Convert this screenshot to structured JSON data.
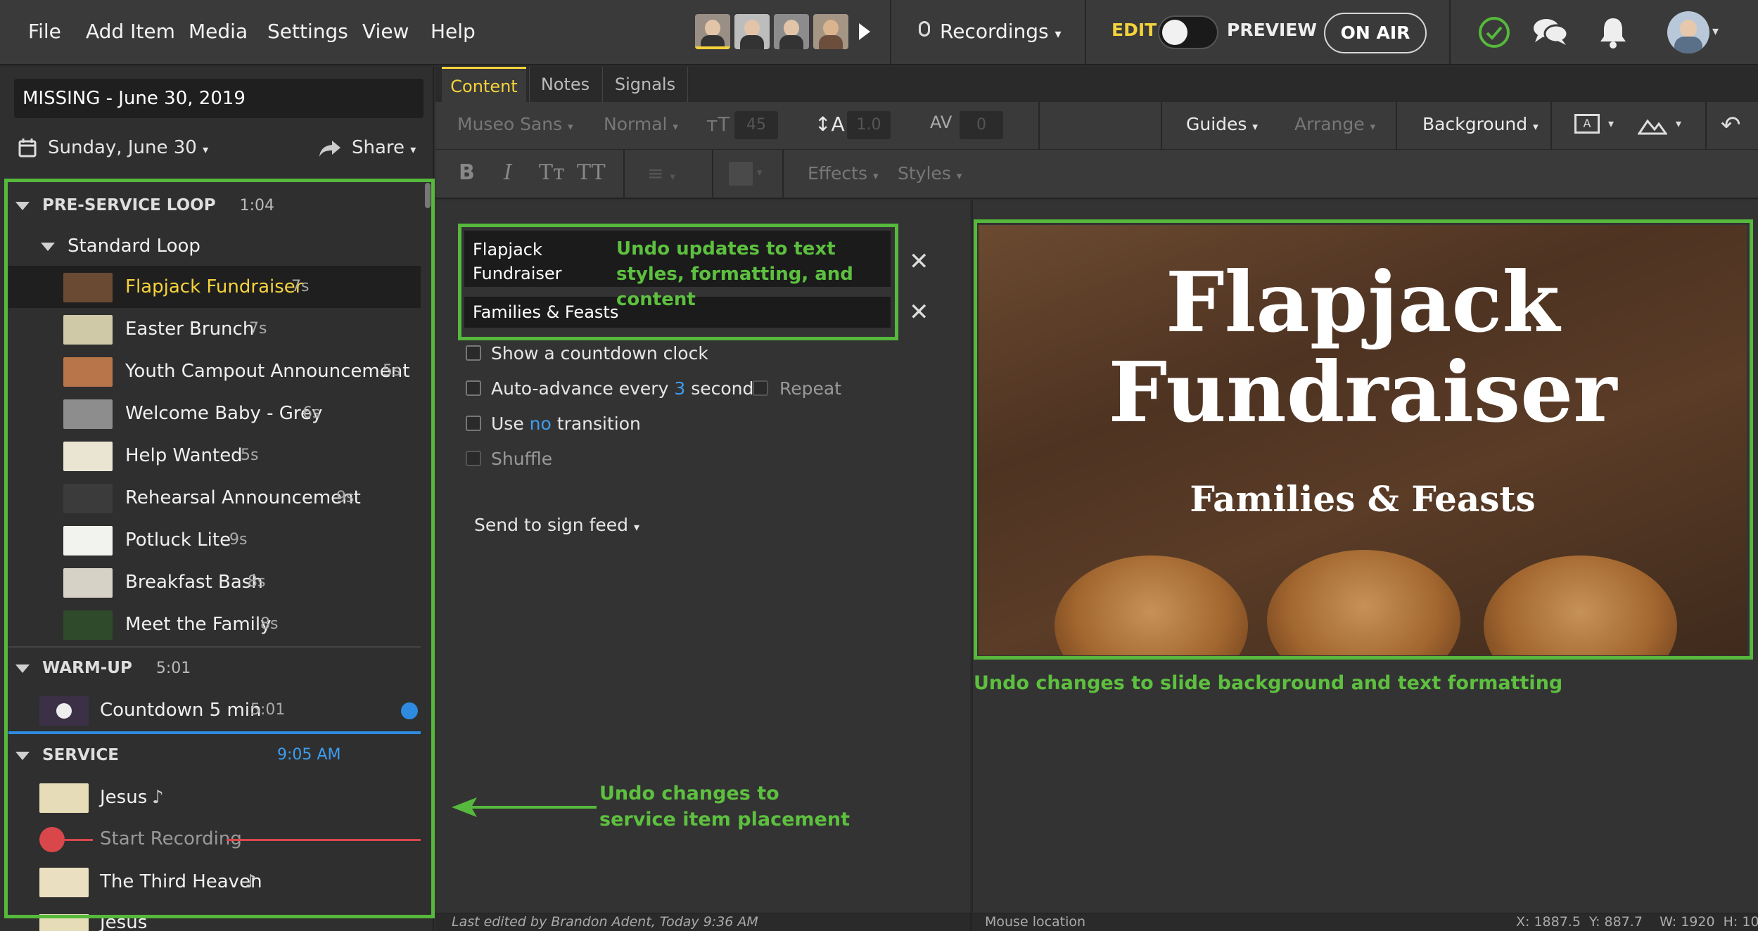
{
  "menu": [
    "File",
    "Add Item",
    "Media",
    "Settings",
    "View",
    "Help"
  ],
  "recordings_label": "Recordings",
  "edit_label": "EDIT",
  "preview_label": "PREVIEW",
  "on_air_label": "ON AIR",
  "plan": {
    "title": "MISSING - June 30, 2019",
    "date": "Sunday, June 30",
    "share": "Share"
  },
  "sections": [
    {
      "name": "PRE-SERVICE LOOP",
      "time": "1:04"
    },
    {
      "name": "WARM-UP",
      "time": "5:01"
    },
    {
      "name": "SERVICE",
      "time": "9:05 AM"
    }
  ],
  "subsection": "Standard Loop",
  "loop_items": [
    {
      "label": "Flapjack Fundraiser",
      "dur": "7s"
    },
    {
      "label": "Easter Brunch",
      "dur": "7s"
    },
    {
      "label": "Youth Campout Announcement",
      "dur": "5s"
    },
    {
      "label": "Welcome Baby - Grey",
      "dur": "6s"
    },
    {
      "label": "Help Wanted",
      "dur": "5s"
    },
    {
      "label": "Rehearsal Announcement",
      "dur": "9s"
    },
    {
      "label": "Potluck Lite",
      "dur": "9s"
    },
    {
      "label": "Breakfast Bash",
      "dur": "8s"
    },
    {
      "label": "Meet the Family",
      "dur": "8s"
    }
  ],
  "warmup_item": {
    "label": "Countdown 5 min",
    "dur": "5:01"
  },
  "service_items": [
    "Jesus",
    "Start Recording",
    "The Third Heaven",
    "Jesus"
  ],
  "tabs": [
    "Content",
    "Notes",
    "Signals"
  ],
  "toolbar": {
    "font": "Museo Sans",
    "weight": "Normal",
    "size": "45",
    "line_height": "1.0",
    "tracking": "0",
    "guides": "Guides",
    "arrange": "Arrange",
    "background": "Background",
    "bold": "B",
    "italic": "I",
    "tt1": "Tт",
    "tt2": "TT",
    "effects": "Effects",
    "styles": "Styles"
  },
  "text_fields": [
    "Flapjack\nFundraiser",
    "Families & Feasts"
  ],
  "options": {
    "countdown": "Show a  countdown clock",
    "advance_pre": "Auto-advance every",
    "advance_num": "3",
    "advance_post": "seconds",
    "repeat": "Repeat",
    "transition_pre": "Use",
    "transition_val": "no",
    "transition_post": "transition",
    "shuffle": "Shuffle",
    "sign_feed": "Send to sign feed"
  },
  "slide": {
    "title_line1": "Flapjack",
    "title_line2": "Fundraiser",
    "subtitle": "Families & Feasts"
  },
  "annotations": {
    "text": "Undo updates to text styles, formatting, and content",
    "slide": "Undo changes to slide background and text formatting",
    "service": "Undo changes to service item placement"
  },
  "status": {
    "last_edited": "Last edited by Brandon Adent, Today 9:36 AM",
    "mouse": "Mouse location",
    "coords": "X: 1887.5  Y: 887.7    W: 1920  H: 1080"
  },
  "colors": {
    "accent_green": "#56b83c",
    "highlight_yellow": "#f4d23c",
    "link_blue": "#3d9df0",
    "record_red": "#d9474b"
  }
}
